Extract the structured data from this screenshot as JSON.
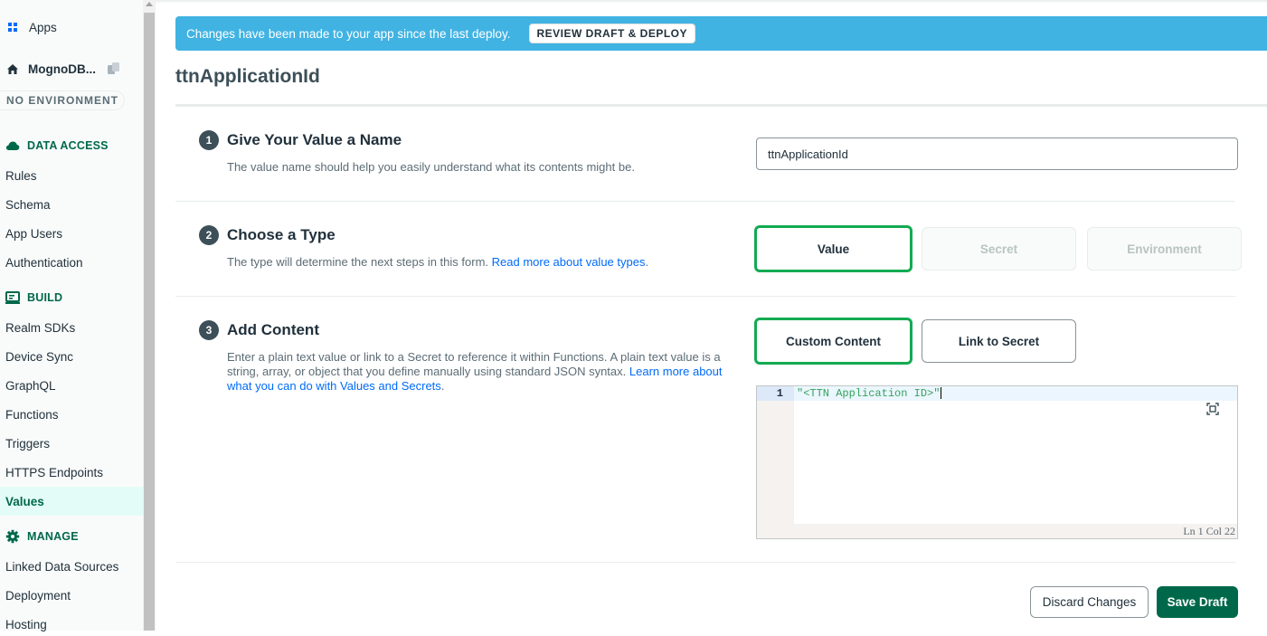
{
  "sidebar": {
    "apps_label": "Apps",
    "project_name": "MognoDB...",
    "environment_badge": "NO ENVIRONMENT",
    "sections": {
      "data_access": {
        "title": "DATA ACCESS",
        "items": [
          "Rules",
          "Schema",
          "App Users",
          "Authentication"
        ]
      },
      "build": {
        "title": "BUILD",
        "items": [
          "Realm SDKs",
          "Device Sync",
          "GraphQL",
          "Functions",
          "Triggers",
          "HTTPS Endpoints",
          "Values"
        ]
      },
      "manage": {
        "title": "MANAGE",
        "items": [
          "Linked Data Sources",
          "Deployment",
          "Hosting"
        ]
      }
    },
    "active_item": "Values"
  },
  "banner": {
    "text": "Changes have been made to your app since the last deploy.",
    "button_label": "REVIEW DRAFT & DEPLOY"
  },
  "page": {
    "title": "ttnApplicationId"
  },
  "steps": {
    "name": {
      "number": "1",
      "title": "Give Your Value a Name",
      "description": "The value name should help you easily understand what its contents might be.",
      "input_value": "ttnApplicationId"
    },
    "type": {
      "number": "2",
      "title": "Choose a Type",
      "description": "The type will determine the next steps in this form. ",
      "link_text": "Read more about value types",
      "link_suffix": ".",
      "options": [
        "Value",
        "Secret",
        "Environment"
      ],
      "selected": "Value"
    },
    "content": {
      "number": "3",
      "title": "Add Content",
      "description": "Enter a plain text value or link to a Secret to reference it within Functions. A plain text value is a string, array, or object that you define manually using standard JSON syntax. ",
      "link_text": "Learn more about what you can do with Values and Secrets",
      "link_suffix": ".",
      "options": [
        "Custom Content",
        "Link to Secret"
      ],
      "selected": "Custom Content",
      "editor": {
        "line_number": "1",
        "code": "\"<TTN Application ID>\"",
        "status": "Ln 1 Col 22"
      }
    }
  },
  "footer": {
    "discard_label": "Discard Changes",
    "save_label": "Save Draft"
  },
  "colors": {
    "accent_green": "#00684a",
    "selected_border": "#13aa52",
    "banner_blue": "#40b3e3",
    "link_blue": "#016bf8"
  }
}
